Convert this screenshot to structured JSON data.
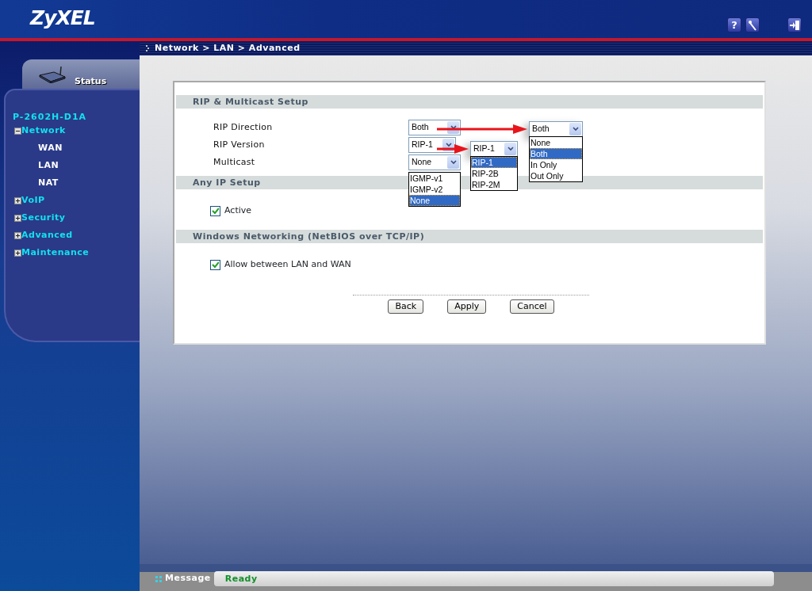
{
  "header": {
    "logo": "ZyXEL",
    "help": "?"
  },
  "breadcrumb": "Network > LAN > Advanced",
  "sidebar": {
    "status_tab": "Status",
    "device": "P-2602H-D1A",
    "menu": [
      {
        "label": "Network",
        "expanded": true,
        "children": [
          {
            "label": "WAN"
          },
          {
            "label": "LAN"
          },
          {
            "label": "NAT"
          }
        ]
      },
      {
        "label": "VoIP",
        "expanded": false
      },
      {
        "label": "Security",
        "expanded": false
      },
      {
        "label": "Advanced",
        "expanded": false
      },
      {
        "label": "Maintenance",
        "expanded": false
      }
    ]
  },
  "sections": [
    {
      "title": "RIP & Multicast Setup",
      "fields": [
        {
          "kind": "select",
          "label": "RIP Direction",
          "value": "Both",
          "callout": {
            "value": "Both",
            "options": [
              {
                "label": "None",
                "selected": false
              },
              {
                "label": "Both",
                "selected": true
              },
              {
                "label": "In Only",
                "selected": false
              },
              {
                "label": "Out Only",
                "selected": false
              }
            ]
          }
        },
        {
          "kind": "select",
          "label": "RIP Version",
          "value": "RIP-1",
          "callout": {
            "value": "RIP-1",
            "options": [
              {
                "label": "RIP-1",
                "selected": true
              },
              {
                "label": "RIP-2B",
                "selected": false
              },
              {
                "label": "RIP-2M",
                "selected": false
              }
            ]
          }
        },
        {
          "kind": "select",
          "label": "Multicast",
          "value": "None",
          "options": [
            {
              "label": "IGMP-v1",
              "selected": false
            },
            {
              "label": "IGMP-v2",
              "selected": false
            },
            {
              "label": "None",
              "selected": true
            }
          ]
        }
      ]
    },
    {
      "title": "Any IP Setup",
      "fields": [
        {
          "kind": "checkbox",
          "label": "Active",
          "checked": true
        }
      ]
    },
    {
      "title": "Windows Networking (NetBIOS over TCP/IP)",
      "fields": [
        {
          "kind": "checkbox",
          "label": "Allow between LAN and WAN",
          "checked": true
        }
      ]
    }
  ],
  "buttons": [
    "Back",
    "Apply",
    "Cancel"
  ],
  "status_bar": {
    "label": "Message",
    "text": "Ready"
  }
}
